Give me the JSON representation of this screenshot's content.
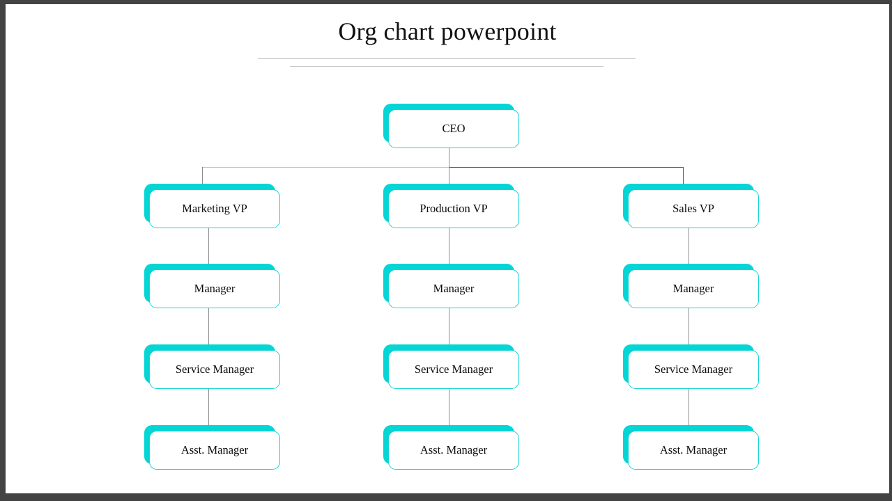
{
  "slide": {
    "title": "Org chart powerpoint",
    "background_color": "#ffffff",
    "frame_color": "#434343",
    "accent_color": "#04d5d5",
    "connector_color": "#8c8c8c"
  },
  "chart_data": {
    "type": "diagram",
    "diagram_type": "org-chart",
    "title": "Org chart powerpoint",
    "orientation": "top-down",
    "levels": 5,
    "columns": 3,
    "nodes": [
      {
        "id": "ceo",
        "label": "CEO",
        "level": 0,
        "column": 1,
        "parent": null
      },
      {
        "id": "vp-mkt",
        "label": "Marketing VP",
        "level": 1,
        "column": 0,
        "parent": "ceo"
      },
      {
        "id": "vp-prod",
        "label": "Production VP",
        "level": 1,
        "column": 1,
        "parent": "ceo"
      },
      {
        "id": "vp-sales",
        "label": "Sales VP",
        "level": 1,
        "column": 2,
        "parent": "ceo"
      },
      {
        "id": "mgr-mkt",
        "label": "Manager",
        "level": 2,
        "column": 0,
        "parent": "vp-mkt"
      },
      {
        "id": "mgr-prod",
        "label": "Manager",
        "level": 2,
        "column": 1,
        "parent": "vp-prod"
      },
      {
        "id": "mgr-sales",
        "label": "Manager",
        "level": 2,
        "column": 2,
        "parent": "vp-sales"
      },
      {
        "id": "svc-mkt",
        "label": "Service Manager",
        "level": 3,
        "column": 0,
        "parent": "mgr-mkt"
      },
      {
        "id": "svc-prod",
        "label": "Service Manager",
        "level": 3,
        "column": 1,
        "parent": "mgr-prod"
      },
      {
        "id": "svc-sales",
        "label": "Service Manager",
        "level": 3,
        "column": 2,
        "parent": "mgr-sales"
      },
      {
        "id": "asst-mkt",
        "label": "Asst. Manager",
        "level": 4,
        "column": 0,
        "parent": "svc-mkt"
      },
      {
        "id": "asst-prod",
        "label": "Asst. Manager",
        "level": 4,
        "column": 1,
        "parent": "svc-prod"
      },
      {
        "id": "asst-sales",
        "label": "Asst. Manager",
        "level": 4,
        "column": 2,
        "parent": "svc-sales"
      }
    ]
  },
  "nodes": {
    "ceo": "CEO",
    "marketing_vp": "Marketing VP",
    "production_vp": "Production VP",
    "sales_vp": "Sales VP",
    "manager_left": "Manager",
    "manager_center": "Manager",
    "manager_right": "Manager",
    "service_manager_left": "Service Manager",
    "service_manager_center": "Service Manager",
    "service_manager_right": "Service Manager",
    "asst_manager_left": "Asst. Manager",
    "asst_manager_center": "Asst. Manager",
    "asst_manager_right": "Asst. Manager"
  }
}
